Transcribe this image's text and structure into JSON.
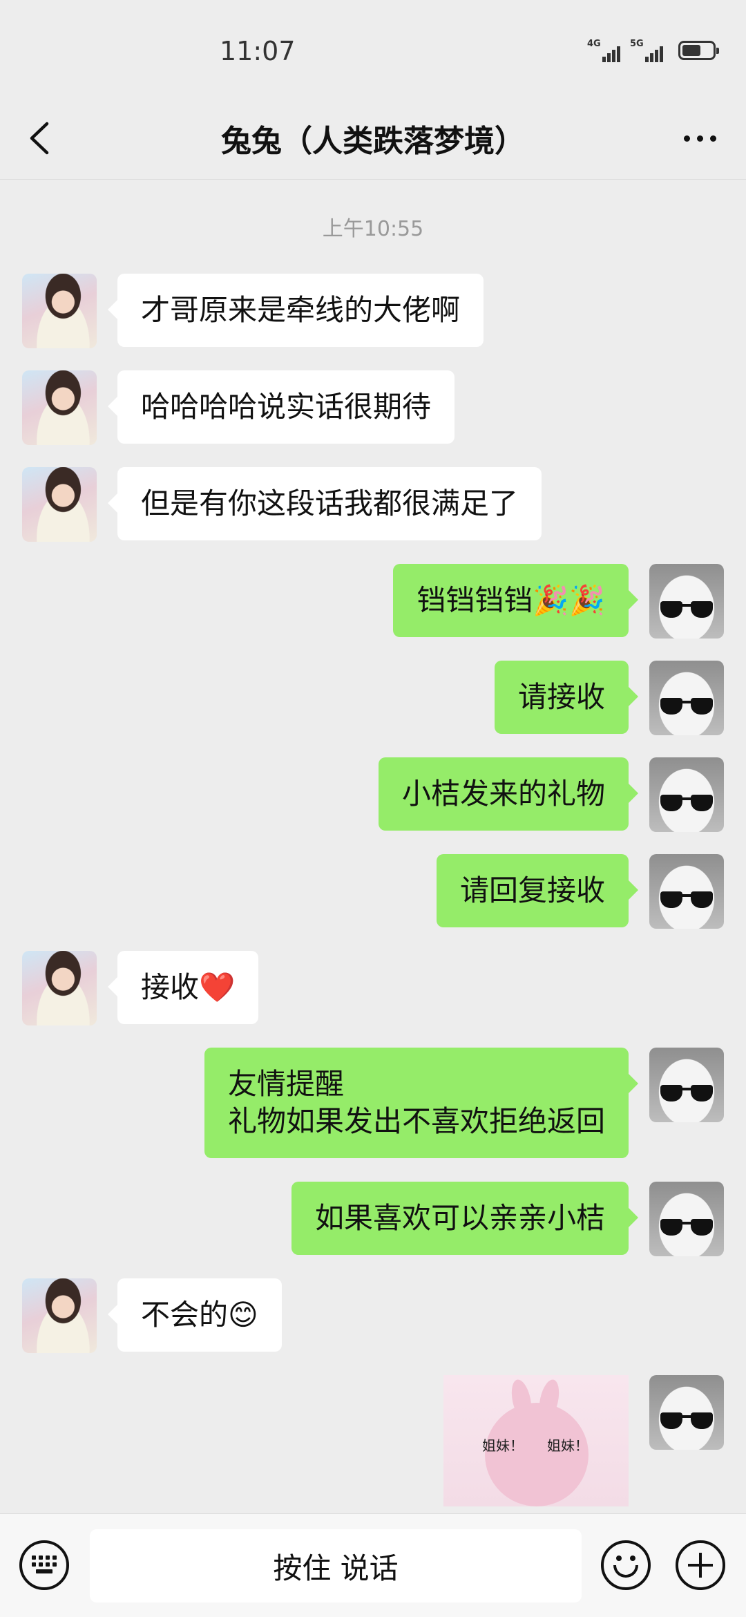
{
  "status_bar": {
    "time": "11:07",
    "network_1": "4G",
    "network_2": "5G",
    "battery_level": 0.55
  },
  "header": {
    "title": "兔兔（人类跌落梦境）",
    "back_icon": "chevron-left-icon",
    "more_icon": "more-dots-icon"
  },
  "conversation": {
    "timestamp": "上午10:55",
    "messages": [
      {
        "side": "left",
        "text": "才哥原来是牵线的大佬啊"
      },
      {
        "side": "left",
        "text": "哈哈哈哈说实话很期待"
      },
      {
        "side": "left",
        "text": "但是有你这段话我都很满足了"
      },
      {
        "side": "right",
        "text": "铛铛铛铛🎉🎉"
      },
      {
        "side": "right",
        "text": "请接收"
      },
      {
        "side": "right",
        "text": "小桔发来的礼物"
      },
      {
        "side": "right",
        "text": "请回复接收"
      },
      {
        "side": "left",
        "text": "接收❤️"
      },
      {
        "side": "right",
        "lines": [
          "友情提醒",
          "礼物如果发出不喜欢拒绝返回"
        ]
      },
      {
        "side": "right",
        "text": "如果喜欢可以亲亲小桔"
      },
      {
        "side": "left",
        "text": "不会的😊"
      },
      {
        "side": "right",
        "sticker": {
          "text_left": "姐妹！",
          "text_right": "姐妹！"
        }
      }
    ]
  },
  "input_bar": {
    "hold_to_talk": "按住 说话",
    "keyboard_icon": "keyboard-icon",
    "emoji_icon": "emoji-icon",
    "plus_icon": "plus-icon"
  },
  "colors": {
    "background": "#ededed",
    "bubble_self": "#95ec69",
    "bubble_other": "#ffffff"
  }
}
